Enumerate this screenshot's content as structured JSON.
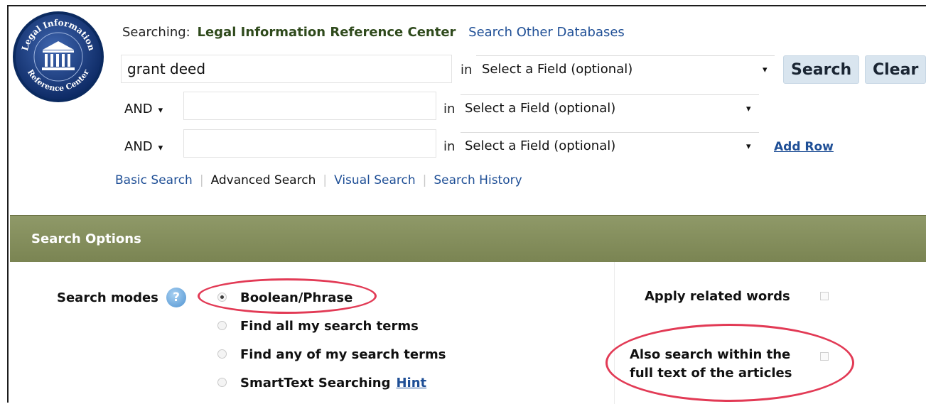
{
  "logo": {
    "top_text": "Legal Information",
    "bottom_text": "Reference Center"
  },
  "header": {
    "searching_label": "Searching:",
    "database_name": "Legal Information Reference Center",
    "other_databases_link": "Search Other Databases"
  },
  "search_rows": [
    {
      "operator": "",
      "term": "grant deed",
      "in_label": "in",
      "field": "Select a Field (optional)"
    },
    {
      "operator": "AND",
      "term": "",
      "in_label": "in",
      "field": "Select a Field (optional)"
    },
    {
      "operator": "AND",
      "term": "",
      "in_label": "in",
      "field": "Select a Field (optional)"
    }
  ],
  "buttons": {
    "search": "Search",
    "clear": "Clear",
    "add_row": "Add Row"
  },
  "tabs": [
    "Basic Search",
    "Advanced Search",
    "Visual Search",
    "Search History"
  ],
  "active_tab": "Advanced Search",
  "options": {
    "title": "Search Options",
    "modes_label": "Search modes",
    "help_glyph": "?",
    "modes": [
      "Boolean/Phrase",
      "Find all my search terms",
      "Find any of my search terms",
      "SmartText Searching"
    ],
    "selected_mode": "Boolean/Phrase",
    "hint_link": "Hint",
    "apply_related_words": "Apply related words",
    "full_text_line1": "Also search within the",
    "full_text_line2": "full text of the articles"
  },
  "colors": {
    "panel_header": "#7f8a56",
    "link": "#1f4f96",
    "annotation_circle": "#e23a55",
    "button_bg": "#d9e5ef"
  },
  "icons": [
    "logo-building-icon",
    "chevron-down-icon",
    "help-icon",
    "radio-icon",
    "checkbox-icon"
  ]
}
